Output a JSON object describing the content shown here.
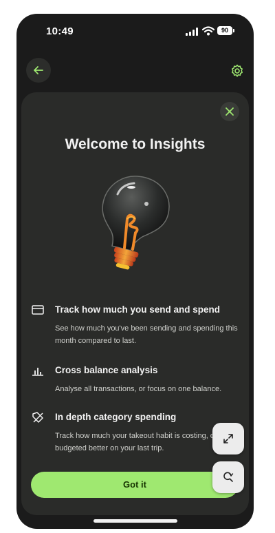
{
  "status_bar": {
    "time": "10:49",
    "battery": "90"
  },
  "nav": {
    "back_icon": "arrow-left-icon",
    "settings_icon": "gear-icon"
  },
  "sheet": {
    "close_icon": "close-icon",
    "title": "Welcome to Insights",
    "illustration": "lightbulb-illustration",
    "features": [
      {
        "icon": "card-icon",
        "title": "Track how much you send and spend",
        "body": "See how much you've been sending and spending this month compared to last."
      },
      {
        "icon": "bar-chart-icon",
        "title": "Cross balance analysis",
        "body": "Analyse all transactions, or focus on one balance."
      },
      {
        "icon": "tag-icon",
        "title": "In depth category spending",
        "body": "Track how much your takeout habit is costing, or if you budgeted better on your last trip."
      }
    ],
    "cta_label": "Got it"
  },
  "floating": {
    "expand_icon": "expand-icon",
    "search_icon": "search-refresh-icon"
  },
  "colors": {
    "accent": "#9fe870",
    "background": "#1b1b1b",
    "sheet": "#2a2b29"
  }
}
